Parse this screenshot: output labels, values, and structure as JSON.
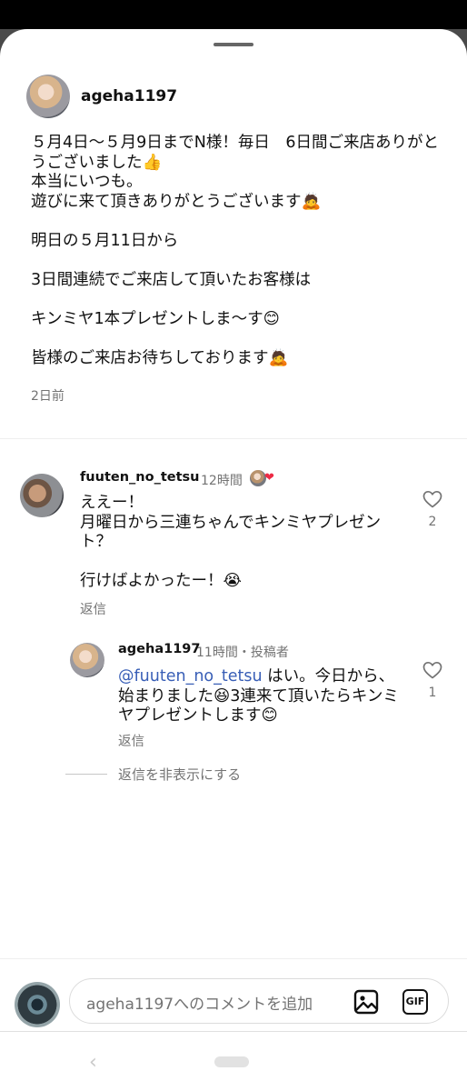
{
  "post": {
    "username": "ageha1197",
    "text": "５月4日〜５月9日までN様！毎日　6日間ご来店ありがとうございました👍\n本当にいつも。\n遊びに来て頂きありがとうございます🙇\n\n明日の５月11日から\n\n3日間連続でご来店して頂いたお客様は\n\nキンミヤ1本プレゼントしま〜す😊\n\n皆様のご来店お待ちしております🙇",
    "time": "2日前"
  },
  "comments": [
    {
      "username": "fuuten_no_tetsu",
      "time": "12時間",
      "text": "ええー！\n月曜日から三連ちゃんでキンミヤプレゼント？\n\n行けばよかったー！😭",
      "reply_label": "返信",
      "like_count": "2"
    }
  ],
  "reply": {
    "username": "ageha1197",
    "meta": "11時間・投稿者",
    "mention": "@fuuten_no_tetsu",
    "text": " はい。今日から、始まりました😆3連来て頂いたらキンミヤプレゼントします😊",
    "reply_label": "返信",
    "like_count": "1"
  },
  "hide_replies_label": "返信を非表示にする",
  "comment_input": {
    "placeholder": "ageha1197へのコメントを追加"
  },
  "icons": {
    "like": "heart-outline-icon",
    "image": "image-icon",
    "gif": "GIF",
    "liked_heart": "heart-filled-icon"
  },
  "colors": {
    "mention": "#385eb6",
    "heart": "#ed2b45",
    "secondary_text": "#737373"
  }
}
